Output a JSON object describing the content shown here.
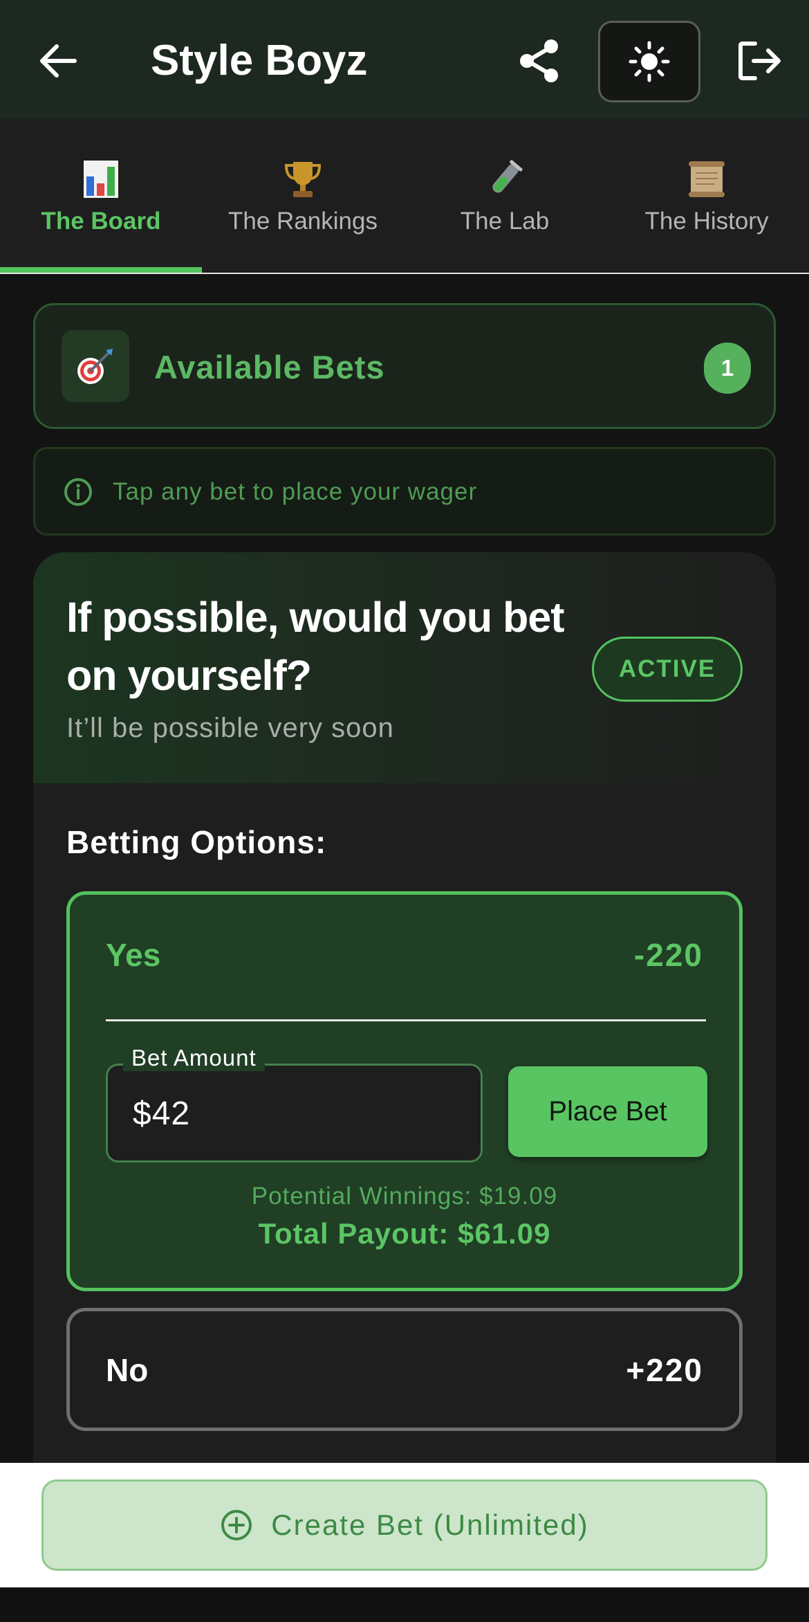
{
  "header": {
    "title": "Style Boyz",
    "back_icon": "arrow-left-icon",
    "share_icon": "share-icon",
    "theme_icon": "sun-icon",
    "logout_icon": "logout-icon"
  },
  "tabs": [
    {
      "label": "The Board",
      "icon": "bar-chart-emoji",
      "active": true
    },
    {
      "label": "The Rankings",
      "icon": "trophy-emoji",
      "active": false
    },
    {
      "label": "The Lab",
      "icon": "test-tube-emoji",
      "active": false
    },
    {
      "label": "The History",
      "icon": "scroll-emoji",
      "active": false
    }
  ],
  "available": {
    "title": "Available Bets",
    "count": "1",
    "icon": "dart-target-emoji"
  },
  "tip": {
    "text": "Tap any bet to place your wager",
    "icon": "info-icon"
  },
  "bet": {
    "question": "If possible, would you bet on yourself?",
    "subtitle": "It’ll be possible very soon",
    "status": "ACTIVE",
    "options_label": "Betting Options:",
    "options": [
      {
        "name": "Yes",
        "odds": "-220",
        "selected": true,
        "amount_label": "Bet Amount",
        "amount_value": "$42",
        "place_label": "Place Bet",
        "winnings": "Potential Winnings: $19.09",
        "payout": "Total Payout: $61.09"
      },
      {
        "name": "No",
        "odds": "+220",
        "selected": false
      }
    ]
  },
  "create": {
    "label": "Create Bet (Unlimited)",
    "icon": "plus-circle-icon"
  },
  "colors": {
    "accent": "#5cc565",
    "header_bg": "#1d2820",
    "page_bg": "#121312",
    "card_bg": "#1e1e1e",
    "create_bg": "#cde6cb"
  }
}
